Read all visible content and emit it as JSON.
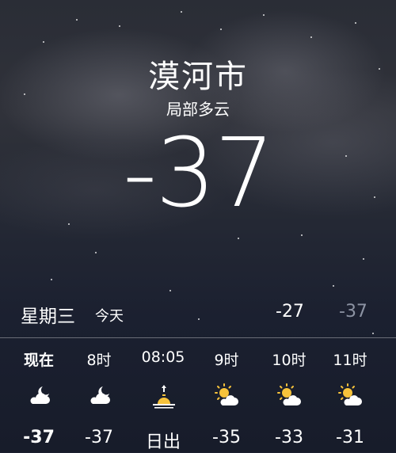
{
  "location": {
    "city": "漠河市",
    "condition": "局部多云",
    "temperature": "-37"
  },
  "today": {
    "weekday": "星期三",
    "label": "今天",
    "high": "-27",
    "low": "-37"
  },
  "hourly": [
    {
      "time": "现在",
      "icon": "cloud-moon-icon",
      "value": "-37"
    },
    {
      "time": "8时",
      "icon": "cloud-moon-icon",
      "value": "-37"
    },
    {
      "time": "08:05",
      "icon": "sunrise-icon",
      "value": "日出"
    },
    {
      "time": "9时",
      "icon": "partly-sunny-icon",
      "value": "-35"
    },
    {
      "time": "10时",
      "icon": "partly-sunny-icon",
      "value": "-33"
    },
    {
      "time": "11时",
      "icon": "partly-sunny-icon",
      "value": "-31"
    }
  ],
  "colors": {
    "sun": "#f7c33b",
    "low_temp": "#8c93a3"
  }
}
